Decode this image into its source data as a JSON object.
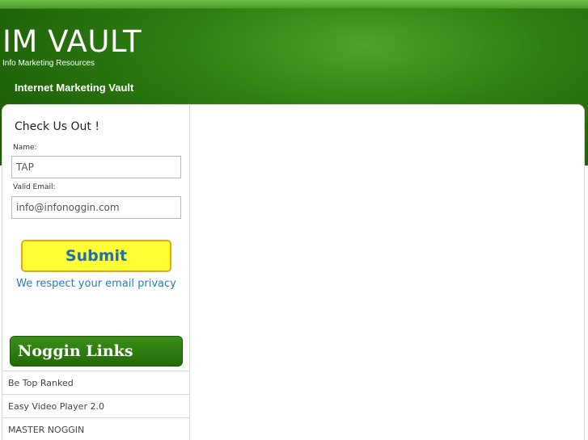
{
  "header": {
    "title": "IM VAULT",
    "tagline": "Info Marketing Resources",
    "nav_link": "Internet Marketing Vault"
  },
  "signup": {
    "title": "Check Us Out !",
    "name_label": "Name:",
    "name_value": "TAP",
    "email_label": "Valid Email:",
    "email_value": "info@infonoggin.com",
    "submit_label": "Submit",
    "privacy_note": "We respect your email privacy"
  },
  "links": {
    "title": "Noggin Links",
    "items": [
      {
        "label": "Be Top Ranked"
      },
      {
        "label": "Easy Video Player 2.0"
      },
      {
        "label": "MASTER NOGGIN"
      }
    ]
  },
  "colors": {
    "header_green": "#2f7d12",
    "submit_bg": "#ffff33",
    "submit_border": "#e3a818",
    "link_blue": "#1f7fc4"
  }
}
